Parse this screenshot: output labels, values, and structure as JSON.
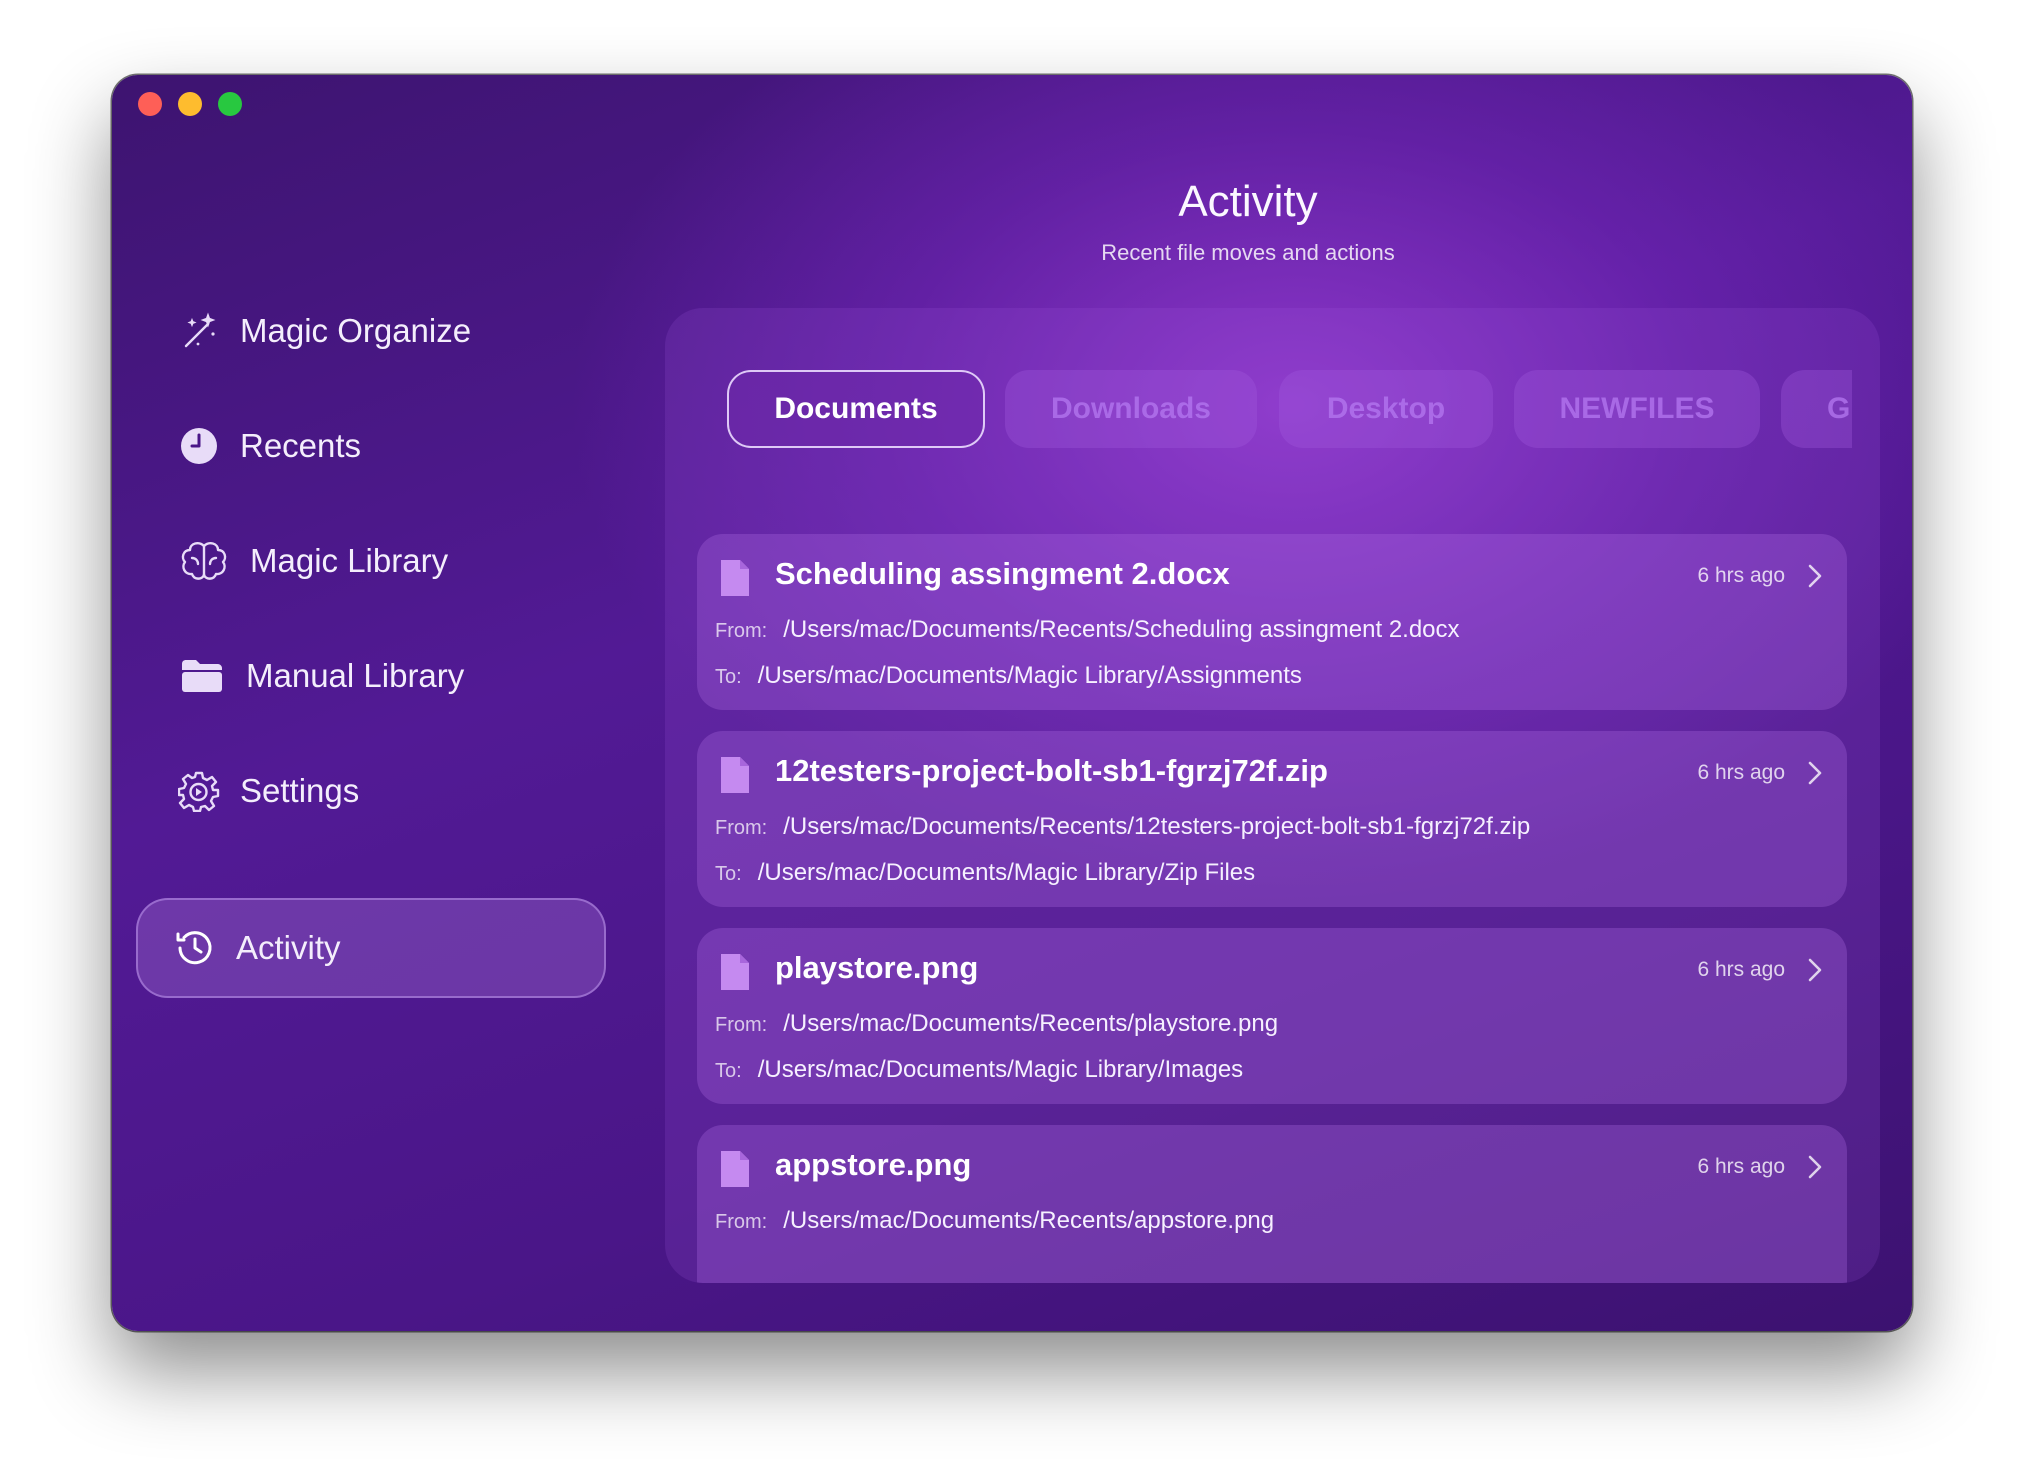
{
  "window": {
    "controls": [
      "close",
      "minimize",
      "zoom"
    ]
  },
  "header": {
    "title": "Activity",
    "subtitle": "Recent file moves and actions"
  },
  "sidebar": {
    "items": [
      {
        "label": "Magic Organize",
        "icon": "magic-wand-icon",
        "active": false
      },
      {
        "label": "Recents",
        "icon": "clock-icon",
        "active": false
      },
      {
        "label": "Magic Library",
        "icon": "brain-icon",
        "active": false
      },
      {
        "label": "Manual Library",
        "icon": "folder-icon",
        "active": false
      },
      {
        "label": "Settings",
        "icon": "gear-icon",
        "active": false
      },
      {
        "label": "Activity",
        "icon": "history-icon",
        "active": true
      }
    ]
  },
  "tabs": [
    {
      "label": "Documents",
      "selected": true
    },
    {
      "label": "Downloads",
      "selected": false
    },
    {
      "label": "Desktop",
      "selected": false
    },
    {
      "label": "NEWFILES",
      "selected": false
    },
    {
      "label": "G",
      "selected": false
    }
  ],
  "activity": {
    "from_label": "From:",
    "to_label": "To:",
    "items": [
      {
        "name": "Scheduling assingment 2.docx",
        "time": "6 hrs ago",
        "from": "/Users/mac/Documents/Recents/Scheduling assingment 2.docx",
        "to": "/Users/mac/Documents/Magic Library/Assignments"
      },
      {
        "name": "12testers-project-bolt-sb1-fgrzj72f.zip",
        "time": "6 hrs ago",
        "from": "/Users/mac/Documents/Recents/12testers-project-bolt-sb1-fgrzj72f.zip",
        "to": "/Users/mac/Documents/Magic Library/Zip Files"
      },
      {
        "name": "playstore.png",
        "time": "6 hrs ago",
        "from": "/Users/mac/Documents/Recents/playstore.png",
        "to": "/Users/mac/Documents/Magic Library/Images"
      },
      {
        "name": "appstore.png",
        "time": "6 hrs ago",
        "from": "/Users/mac/Documents/Recents/appstore.png",
        "to": ""
      }
    ]
  },
  "colors": {
    "accent": "#c58af0",
    "background_dark": "#3d1470",
    "background_glow": "#8a3dc8"
  }
}
